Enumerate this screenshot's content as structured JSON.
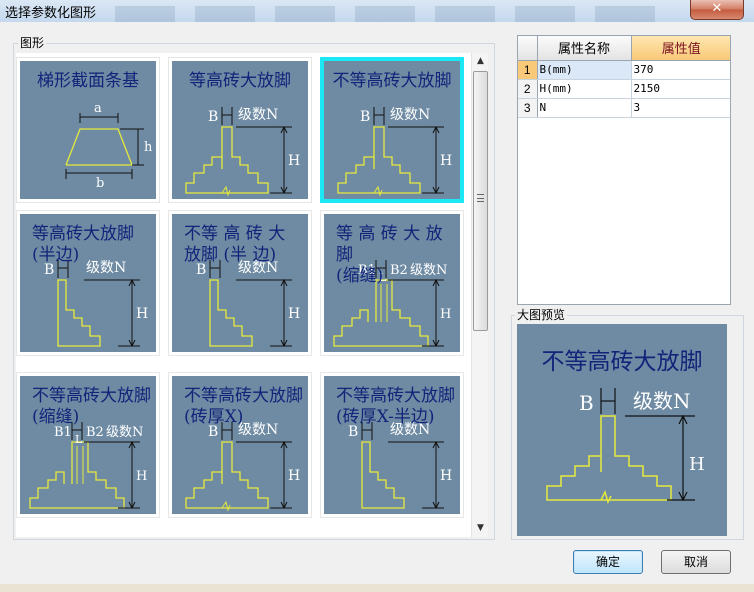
{
  "window": {
    "title": "选择参数化图形",
    "close_glyph": "✕"
  },
  "shape_group": {
    "label": "图形",
    "tiles": [
      {
        "title": "梯形截面条基",
        "labels": [
          "a",
          "h",
          "b"
        ]
      },
      {
        "title": "等高砖大放脚",
        "labels": [
          "B",
          "级数N",
          "H"
        ]
      },
      {
        "title": "不等高砖大放脚",
        "labels": [
          "B",
          "级数N",
          "H"
        ]
      },
      {
        "title": "等高砖大放脚\n(半边)",
        "labels": [
          "B",
          "级数N",
          "H"
        ]
      },
      {
        "title": "不等 高 砖 大\n放脚 (半 边)",
        "labels": [
          "B",
          "级数N",
          "H"
        ]
      },
      {
        "title": "等 高 砖 大 放 脚\n(缩缝)",
        "labels": [
          "B1",
          "B2",
          "L",
          "级数N",
          "H"
        ]
      },
      {
        "title": "不等高砖大放脚\n(缩缝)",
        "labels": [
          "B1",
          "B2",
          "L",
          "级数N",
          "H"
        ]
      },
      {
        "title": "不等高砖大放脚\n(砖厚X)",
        "labels": [
          "B",
          "级数N",
          "H"
        ]
      },
      {
        "title": "不等高砖大放脚\n(砖厚X-半边)",
        "labels": [
          "B",
          "级数N",
          "H"
        ]
      }
    ],
    "selected_index": 2
  },
  "scrollbar": {
    "up_glyph": "▲",
    "down_glyph": "▼"
  },
  "properties": {
    "columns": [
      "属性名称",
      "属性值"
    ],
    "rows": [
      {
        "index": "1",
        "name": "B(mm)",
        "value": "370"
      },
      {
        "index": "2",
        "name": "H(mm)",
        "value": "2150"
      },
      {
        "index": "3",
        "name": "N",
        "value": "3"
      }
    ],
    "current_row": 0
  },
  "preview": {
    "label": "大图预览",
    "title": "不等高砖大放脚",
    "labels": [
      "B",
      "级数N",
      "H"
    ]
  },
  "buttons": {
    "ok": "确定",
    "cancel": "取消"
  },
  "colors": {
    "tile_bg": "#6e8ba3",
    "tile_title": "#13237a",
    "drawing_line": "#e6ea3c",
    "selection": "#1ce8f5"
  }
}
